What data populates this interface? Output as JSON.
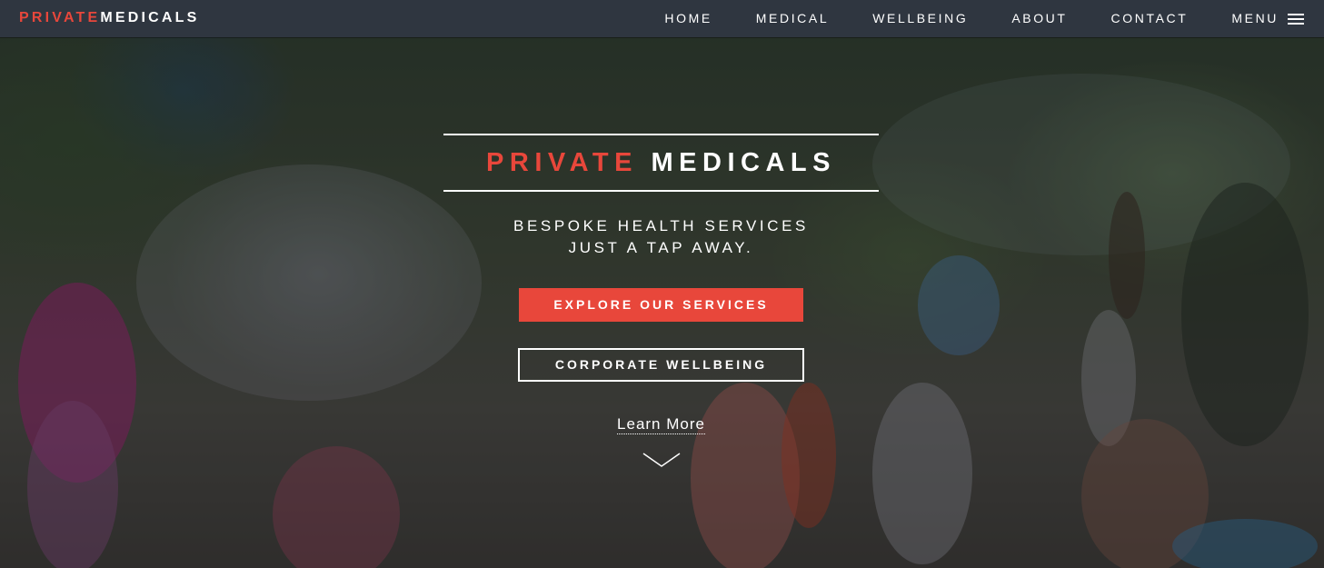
{
  "brand": {
    "accent": "PRIVATE",
    "rest": "MEDICALS"
  },
  "nav": {
    "items": [
      {
        "label": "HOME"
      },
      {
        "label": "MEDICAL"
      },
      {
        "label": "WELLBEING"
      },
      {
        "label": "ABOUT"
      },
      {
        "label": "CONTACT"
      }
    ],
    "menu_label": "MENU"
  },
  "hero": {
    "title_accent": "PRIVATE",
    "title_rest": "MEDICALS",
    "tagline_line1": "BESPOKE HEALTH SERVICES",
    "tagline_line2": "JUST A TAP AWAY.",
    "primary_button": "EXPLORE OUR SERVICES",
    "secondary_button": "CORPORATE WELLBEING",
    "learn_more": "Learn More"
  },
  "icons": {
    "menu": "hamburger-icon",
    "scroll": "chevron-down-icon"
  },
  "colors": {
    "accent": "#e8473b",
    "navbar": "#2f3640",
    "text": "#ffffff"
  }
}
